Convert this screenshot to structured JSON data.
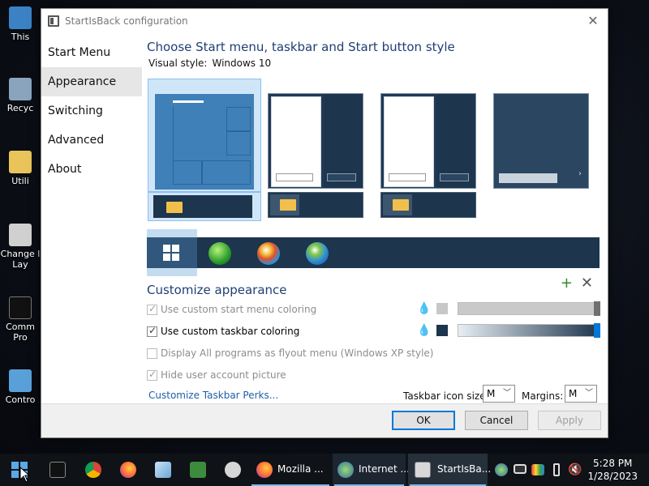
{
  "desktop": {
    "icons": [
      {
        "label": "This"
      },
      {
        "label": "Recyc"
      },
      {
        "label": "Utili"
      },
      {
        "label": "Change l",
        "label2": "Lay"
      },
      {
        "label": "Comm",
        "label2": "Pro"
      },
      {
        "label": "Contro"
      }
    ]
  },
  "window": {
    "title": "StartIsBack configuration",
    "sidebar": {
      "items": [
        {
          "label": "Start Menu"
        },
        {
          "label": "Appearance"
        },
        {
          "label": "Switching"
        },
        {
          "label": "Advanced"
        },
        {
          "label": "About"
        }
      ]
    },
    "main": {
      "heading": "Choose Start menu, taskbar and Start button style",
      "visual_style_label": "Visual style:",
      "visual_style_value": "Windows 10",
      "customize_heading": "Customize appearance",
      "options": [
        {
          "label": "Use custom start menu coloring",
          "checked": true,
          "enabled": false
        },
        {
          "label": "Use custom taskbar coloring",
          "checked": true,
          "enabled": true
        },
        {
          "label": "Display All programs as flyout menu (Windows XP style)",
          "checked": false,
          "enabled": false
        },
        {
          "label": "Hide user account picture",
          "checked": true,
          "enabled": false
        }
      ],
      "link": "Customize Taskbar Perks...",
      "taskbar_icon_size_label": "Taskbar icon size:",
      "taskbar_icon_size_value": "M",
      "margins_label": "Margins:",
      "margins_value": "M"
    },
    "buttons": {
      "ok": "OK",
      "cancel": "Cancel",
      "apply": "Apply"
    }
  },
  "taskbar": {
    "items": [
      {
        "label": "Mozilla ..."
      },
      {
        "label": "Internet ..."
      },
      {
        "label": "StartIsBa..."
      }
    ],
    "clock_time": "5:28 PM",
    "clock_date": "1/28/2023"
  },
  "colors": {
    "accent": "#0078d7",
    "heading": "#1e3f74",
    "taskbar_color": "#1d354d",
    "menu_color_swatch": "#c8c8c8"
  }
}
